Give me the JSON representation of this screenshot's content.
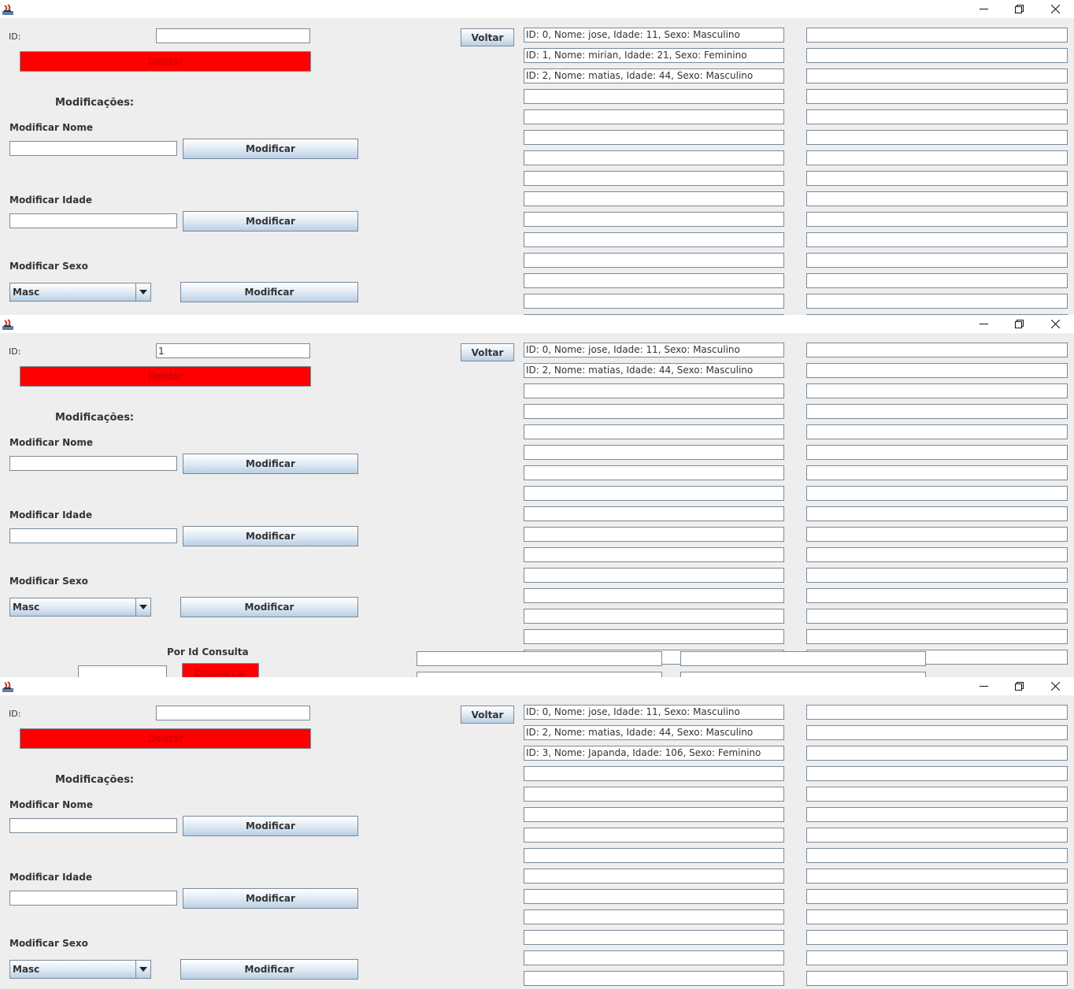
{
  "screens": [
    {
      "id_label": "ID:",
      "id_value": "",
      "delete_label": "Deletar",
      "back_label": "Voltar",
      "mods_title": "Modificações:",
      "name_label": "Modificar Nome",
      "name_value": "",
      "age_label": "Modificar Idade",
      "age_value": "",
      "sex_label": "Modificar Sexo",
      "sex_selected": "Masc",
      "modify_label": "Modificar",
      "records": [
        "ID: 0, Nome: jose, Idade: 11, Sexo: Masculino",
        "ID: 1, Nome: mirian, Idade: 21, Sexo: Feminino",
        "ID: 2, Nome: matias, Idade: 44, Sexo: Masculino",
        "",
        "",
        "",
        "",
        "",
        "",
        "",
        "",
        "",
        "",
        "",
        ""
      ],
      "records_right": [
        "",
        "",
        "",
        "",
        "",
        "",
        "",
        "",
        "",
        "",
        "",
        "",
        "",
        "",
        ""
      ]
    },
    {
      "id_label": "ID:",
      "id_value": "1",
      "delete_label": "Deletar",
      "back_label": "Voltar",
      "mods_title": "Modificações:",
      "name_label": "Modificar Nome",
      "name_value": "",
      "age_label": "Modificar Idade",
      "age_value": "",
      "sex_label": "Modificar Sexo",
      "sex_selected": "Masc",
      "modify_label": "Modificar",
      "records": [
        "ID: 0, Nome: jose, Idade: 11, Sexo: Masculino",
        "ID: 2, Nome: matias, Idade: 44, Sexo: Masculino",
        "",
        "",
        "",
        "",
        "",
        "",
        "",
        "",
        "",
        "",
        "",
        "",
        "",
        ""
      ],
      "records_right": [
        "",
        "",
        "",
        "",
        "",
        "",
        "",
        "",
        "",
        "",
        "",
        "",
        "",
        "",
        "",
        ""
      ],
      "consulta_label": "Por Id Consulta",
      "consulta_value": "",
      "unmark_label": "Desmarcar",
      "consulta_results_left": [
        "",
        ""
      ],
      "consulta_results_right": [
        "",
        ""
      ]
    },
    {
      "id_label": "ID:",
      "id_value": "",
      "delete_label": "Deletar",
      "back_label": "Voltar",
      "mods_title": "Modificações:",
      "name_label": "Modificar Nome",
      "name_value": "",
      "age_label": "Modificar Idade",
      "age_value": "",
      "sex_label": "Modificar Sexo",
      "sex_selected": "Masc",
      "modify_label": "Modificar",
      "records": [
        "ID: 0, Nome: jose, Idade: 11, Sexo: Masculino",
        "ID: 2, Nome: matias, Idade: 44, Sexo: Masculino",
        "ID: 3, Nome: Japanda, Idade: 106, Sexo: Feminino",
        "",
        "",
        "",
        "",
        "",
        "",
        "",
        "",
        "",
        "",
        "",
        ""
      ],
      "records_right": [
        "",
        "",
        "",
        "",
        "",
        "",
        "",
        "",
        "",
        "",
        "",
        "",
        "",
        "",
        ""
      ]
    }
  ]
}
